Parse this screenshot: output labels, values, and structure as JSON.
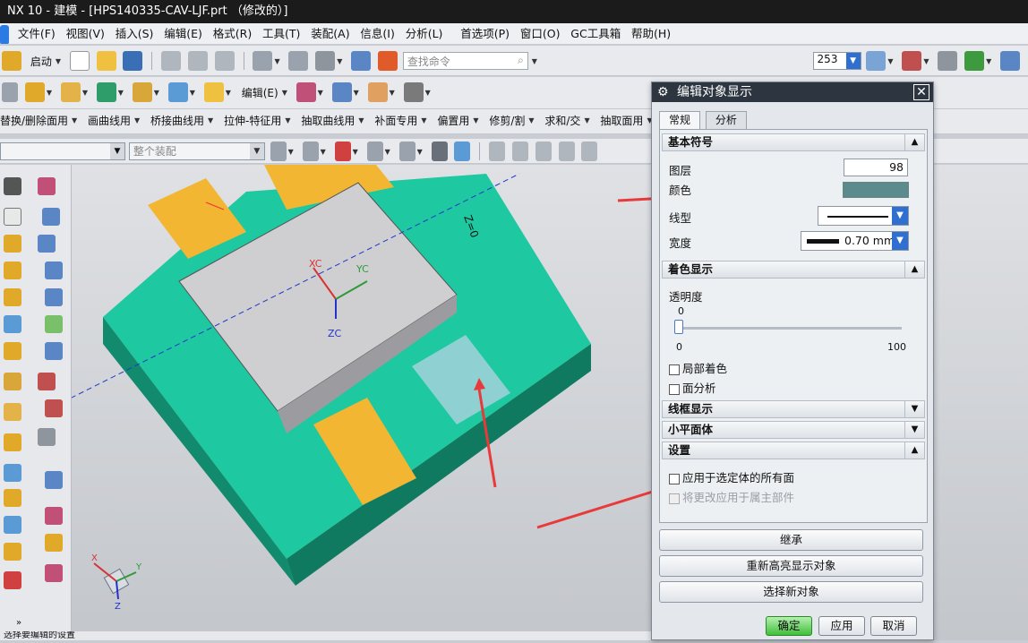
{
  "app": {
    "title": "NX 10 - 建模 - [HPS140335-CAV-LJF.prt （修改的）]"
  },
  "menu": [
    "文件(F)",
    "视图(V)",
    "插入(S)",
    "编辑(E)",
    "格式(R)",
    "工具(T)",
    "装配(A)",
    "信息(I)",
    "分析(L)",
    "首选项(P)",
    "窗口(O)",
    "GC工具箱",
    "帮助(H)"
  ],
  "toolbar1": {
    "start": "启动",
    "search_placeholder": "查找命令",
    "layer_value": "253"
  },
  "toolbar2": {
    "edit_label": "编辑(E)"
  },
  "toolbar3": {
    "items": [
      "替换/删除面用",
      "画曲线用",
      "桥接曲线用",
      "拉伸-特征用",
      "抽取曲线用",
      "补面专用",
      "偏置用",
      "修剪/割",
      "求和/交",
      "抽取面用"
    ]
  },
  "toolbar4": {
    "filter_value": "",
    "assembly_value": "整个装配"
  },
  "viewport": {
    "xc": "XC",
    "yc": "YC",
    "zc": "ZC",
    "z0": "Z=0",
    "axis_x": "X",
    "axis_y": "Y",
    "axis_z": "Z"
  },
  "dialog": {
    "title": "编辑对象显示",
    "tabs": [
      "常规",
      "分析"
    ],
    "basic": {
      "header": "基本符号",
      "layer_label": "图层",
      "layer_value": "98",
      "color_label": "颜色",
      "color_value": "#5b8b8c",
      "linetype_label": "线型",
      "width_label": "宽度",
      "width_value": "0.70 mm"
    },
    "shading": {
      "header": "着色显示",
      "transparency_label": "透明度",
      "slider_min": "0",
      "slider_max": "100",
      "slider_current": "0",
      "slider_fraction": 0.0,
      "partial_shading": "局部着色",
      "face_analysis": "面分析"
    },
    "wireframe": {
      "header": "线框显示"
    },
    "facets": {
      "header": "小平面体"
    },
    "settings": {
      "header": "设置",
      "apply_all_faces": "应用于选定体的所有面",
      "apply_to_owner": "将更改应用于属主部件"
    },
    "buttons": {
      "inherit": "继承",
      "rehighlight": "重新高亮显示对象",
      "select_new": "选择新对象",
      "ok": "确定",
      "apply": "应用",
      "cancel": "取消"
    }
  },
  "status": {
    "text": "选择要编辑的设置"
  }
}
